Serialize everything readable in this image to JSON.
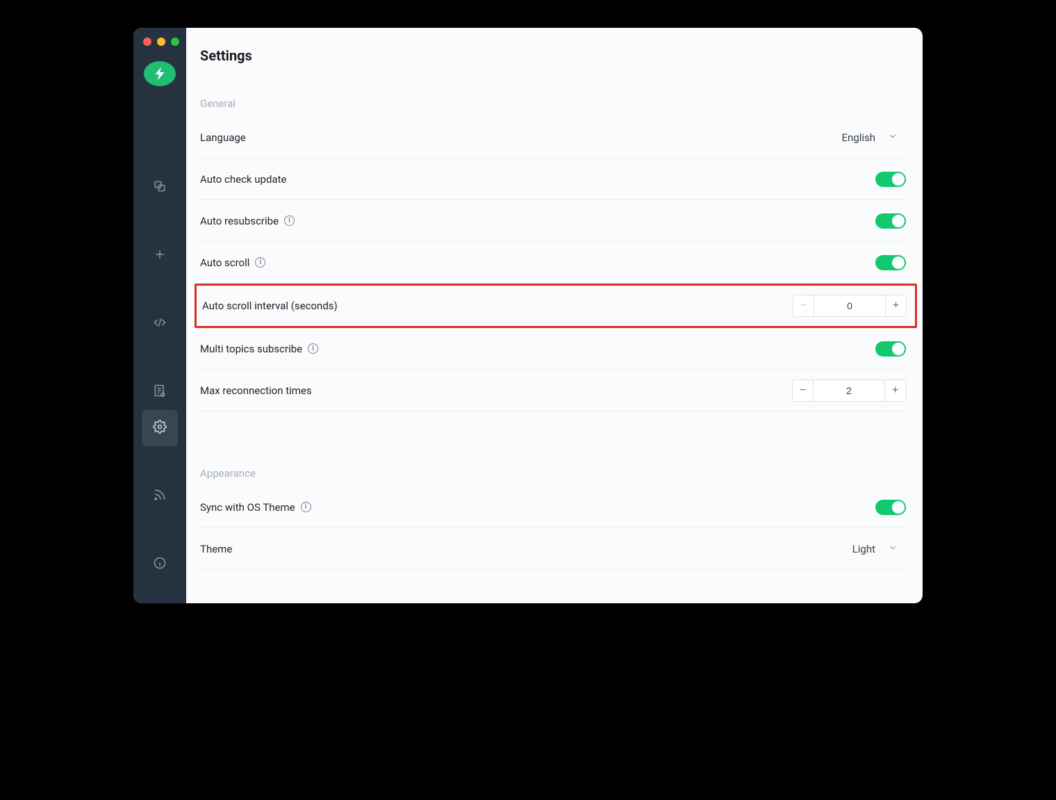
{
  "page": {
    "title": "Settings"
  },
  "sections": {
    "general": {
      "label": "General",
      "language": {
        "label": "Language",
        "value": "English"
      },
      "auto_check_update": {
        "label": "Auto check update",
        "on": true
      },
      "auto_resubscribe": {
        "label": "Auto resubscribe",
        "on": true
      },
      "auto_scroll": {
        "label": "Auto scroll",
        "on": true
      },
      "auto_scroll_interval": {
        "label": "Auto scroll interval (seconds)",
        "value": "0"
      },
      "multi_topics": {
        "label": "Multi topics subscribe",
        "on": true
      },
      "max_reconnect": {
        "label": "Max reconnection times",
        "value": "2"
      }
    },
    "appearance": {
      "label": "Appearance",
      "sync_os": {
        "label": "Sync with OS Theme",
        "on": true
      },
      "theme": {
        "label": "Theme",
        "value": "Light"
      }
    }
  }
}
